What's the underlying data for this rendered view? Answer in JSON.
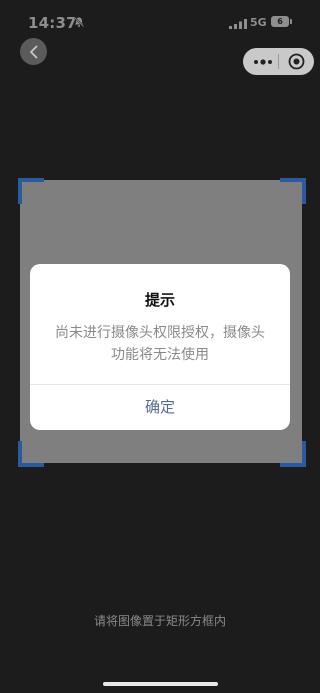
{
  "status_bar": {
    "time": "14:37",
    "network": "5G",
    "battery": "6",
    "icons": [
      "bell-off-icon",
      "signal-icon",
      "battery-icon"
    ]
  },
  "nav": {
    "back_icon": "chevron-left-icon",
    "capsule_icons": [
      "more-dots-icon",
      "target-circle-icon"
    ]
  },
  "dialog": {
    "title": "提示",
    "message": "尚未进行摄像头权限授权，摄像头功能将无法使用",
    "confirm_label": "确定"
  },
  "scanner": {
    "hint": "请将图像置于矩形方框内"
  },
  "colors": {
    "background": "#1c1c1c",
    "frame": "#7f7f7f",
    "corner_accent": "#2c5aa0",
    "dialog_button": "#576b95"
  }
}
